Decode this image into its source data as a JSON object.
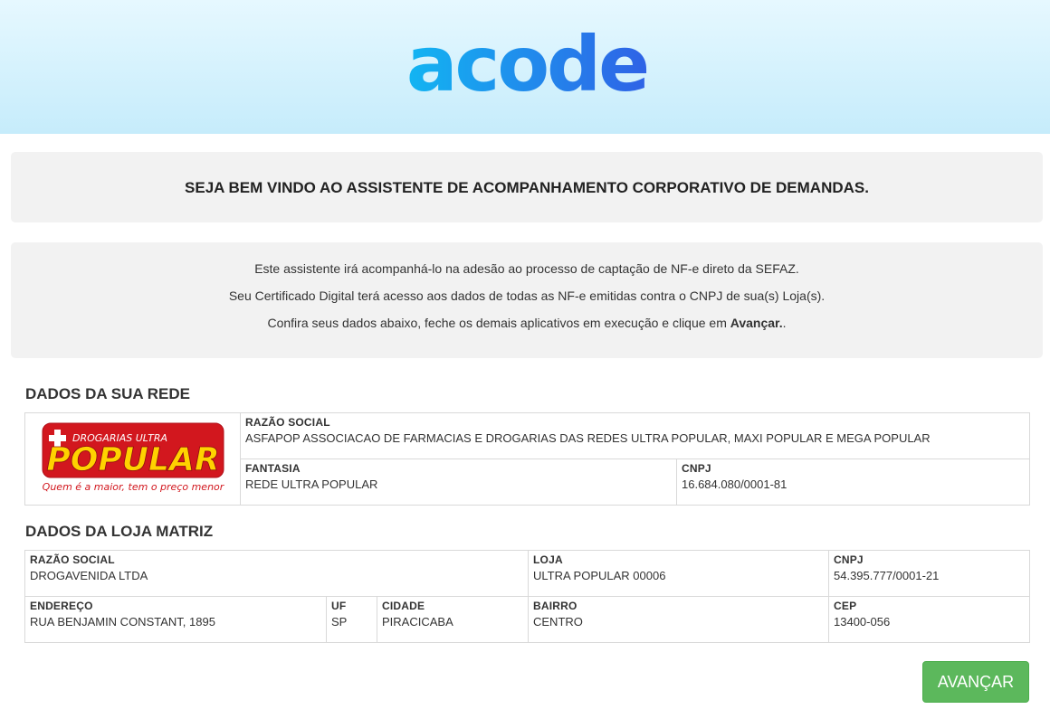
{
  "header": {
    "logo_text": "acode"
  },
  "welcome": {
    "title": "SEJA BEM VINDO AO ASSISTENTE DE ACOMPANHAMENTO CORPORATIVO DE DEMANDAS."
  },
  "info": {
    "line1": "Este assistente irá acompanhá-lo na adesão ao processo de captação de NF-e direto da SEFAZ.",
    "line2": "Seu Certificado Digital terá acesso aos dados de todas as NF-e emitidas contra o CNPJ de sua(s) Loja(s).",
    "line3_prefix": "Confira seus dados abaixo, feche os demais aplicativos em execução e clique em ",
    "line3_bold": "Avançar.",
    "line3_suffix": "."
  },
  "rede": {
    "section_title": "DADOS DA SUA REDE",
    "logo": {
      "top_text": "DROGARIAS ULTRA",
      "main_text": "POPULAR",
      "slogan": "Quem é a maior, tem o preço menor",
      "red": "#d2171e",
      "yellow": "#ffd200"
    },
    "razao_social_label": "RAZÃO SOCIAL",
    "razao_social": "ASFAPOP ASSOCIACAO DE FARMACIAS E DROGARIAS DAS REDES ULTRA POPULAR, MAXI POPULAR E MEGA POPULAR",
    "fantasia_label": "FANTASIA",
    "fantasia": "REDE ULTRA POPULAR",
    "cnpj_label": "CNPJ",
    "cnpj": "16.684.080/0001-81"
  },
  "matriz": {
    "section_title": "DADOS DA LOJA MATRIZ",
    "razao_social_label": "RAZÃO SOCIAL",
    "razao_social": "DROGAVENIDA LTDA",
    "loja_label": "LOJA",
    "loja": "ULTRA POPULAR 00006",
    "cnpj_label": "CNPJ",
    "cnpj": "54.395.777/0001-21",
    "endereco_label": "ENDEREÇO",
    "endereco": "RUA BENJAMIN CONSTANT, 1895",
    "uf_label": "UF",
    "uf": "SP",
    "cidade_label": "CIDADE",
    "cidade": "PIRACICABA",
    "bairro_label": "BAIRRO",
    "bairro": "CENTRO",
    "cep_label": "CEP",
    "cep": "13400-056"
  },
  "actions": {
    "avancar_label": "AVANÇAR",
    "button_color": "#5cb85c"
  },
  "colors": {
    "logo_blue_light": "#11b3f0",
    "logo_blue_dark": "#2d4fe0",
    "header_bg": "#d4f1fc",
    "panel_bg": "#f2f2f2"
  }
}
